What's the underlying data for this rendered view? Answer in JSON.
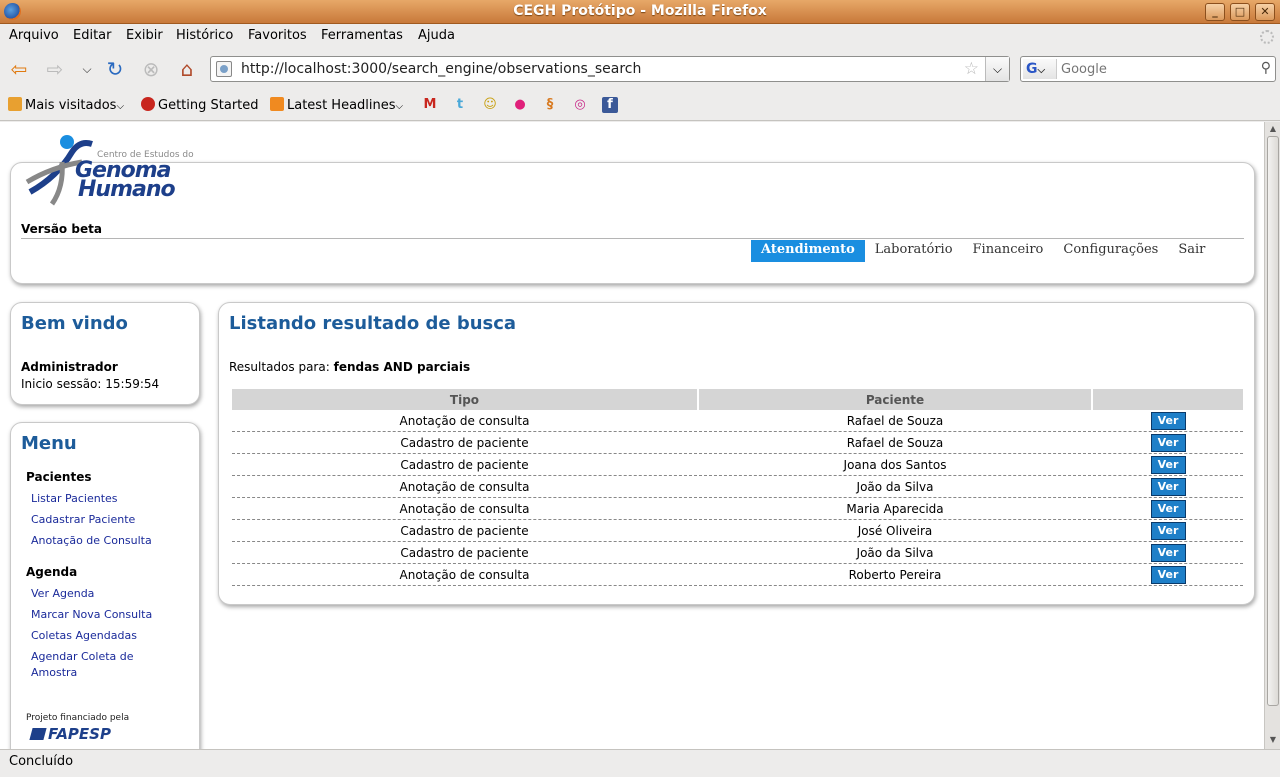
{
  "window": {
    "title": "CEGH Protótipo - Mozilla Firefox",
    "minimize": "_",
    "maximize": "□",
    "close": "✕"
  },
  "menubar": [
    "Arquivo",
    "Editar",
    "Exibir",
    "Histórico",
    "Favoritos",
    "Ferramentas",
    "Ajuda"
  ],
  "navbar": {
    "url": "http://localhost:3000/search_engine/observations_search",
    "search_placeholder": "Google",
    "search_engine": "G"
  },
  "bookmarks": {
    "most_visited": "Mais visitados",
    "getting_started": "Getting Started",
    "latest_headlines": "Latest Headlines"
  },
  "site": {
    "logo_small": "Centro de Estudos do",
    "logo_line1": "Genoma",
    "logo_line2": "Humano",
    "beta": "Versão beta",
    "nav": [
      "Atendimento",
      "Laboratório",
      "Financeiro",
      "Configurações",
      "Sair"
    ],
    "accent_color": "#1a8ee0"
  },
  "welcome": {
    "title": "Bem vindo",
    "user": "Administrador",
    "session": "Inicio sessão: 15:59:54"
  },
  "menu": {
    "title": "Menu",
    "pacientes": {
      "heading": "Pacientes",
      "links": [
        "Listar Pacientes",
        "Cadastrar Paciente",
        "Anotação de Consulta"
      ]
    },
    "agenda": {
      "heading": "Agenda",
      "links": [
        "Ver Agenda",
        "Marcar Nova Consulta",
        "Coletas Agendadas",
        "Agendar Coleta de Amostra"
      ]
    },
    "funded_by": "Projeto financiado pela",
    "funder": "FAPESP"
  },
  "main": {
    "title": "Listando resultado de busca",
    "results_for_label": "Resultados para:",
    "query": "fendas AND parciais",
    "columns": [
      "Tipo",
      "Paciente",
      ""
    ],
    "button_label": "Ver",
    "rows": [
      {
        "tipo": "Anotação de consulta",
        "paciente": "Rafael de Souza"
      },
      {
        "tipo": "Cadastro de paciente",
        "paciente": "Rafael de Souza"
      },
      {
        "tipo": "Cadastro de paciente",
        "paciente": "Joana dos Santos"
      },
      {
        "tipo": "Anotação de consulta",
        "paciente": "João da Silva"
      },
      {
        "tipo": "Anotação de consulta",
        "paciente": "Maria Aparecida"
      },
      {
        "tipo": "Cadastro de paciente",
        "paciente": "José Oliveira"
      },
      {
        "tipo": "Cadastro de paciente",
        "paciente": "João da Silva"
      },
      {
        "tipo": "Anotação de consulta",
        "paciente": "Roberto Pereira"
      }
    ]
  },
  "status": "Concluído"
}
